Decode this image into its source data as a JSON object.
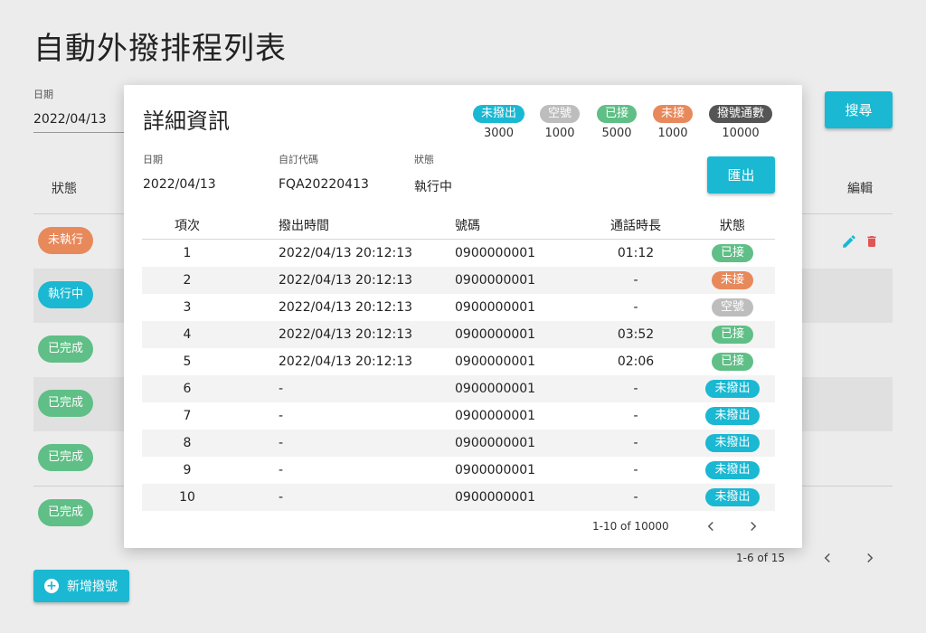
{
  "page": {
    "title": "自動外撥排程列表",
    "date_label": "日期",
    "date_value": "2022/04/13",
    "search_label": "搜尋",
    "col_status": "狀態",
    "col_edit": "編輯",
    "rows": [
      {
        "status": "未執行",
        "color": "#e8895c"
      },
      {
        "status": "執行中",
        "color": "#1ab8d2"
      },
      {
        "status": "已完成",
        "color": "#5fbf86"
      },
      {
        "status": "已完成",
        "color": "#5fbf86"
      },
      {
        "status": "已完成",
        "color": "#5fbf86"
      },
      {
        "status": "已完成",
        "color": "#5fbf86"
      }
    ],
    "pagination": "1-6 of 15",
    "add_label": "新增撥號"
  },
  "modal": {
    "title": "詳細資訊",
    "summary": [
      {
        "label": "未撥出",
        "count": "3000",
        "color": "#1ab8d2"
      },
      {
        "label": "空號",
        "count": "1000",
        "color": "#bdbdbd"
      },
      {
        "label": "已接",
        "count": "5000",
        "color": "#5fbf86"
      },
      {
        "label": "未接",
        "count": "1000",
        "color": "#e8895c"
      },
      {
        "label": "撥號通數",
        "count": "10000",
        "color": "#555555"
      }
    ],
    "info": {
      "date_label": "日期",
      "date_value": "2022/04/13",
      "code_label": "自訂代碼",
      "code_value": "FQA20220413",
      "status_label": "狀態",
      "status_value": "執行中"
    },
    "export_label": "匯出",
    "columns": {
      "no": "項次",
      "time": "撥出時間",
      "phone": "號碼",
      "duration": "通話時長",
      "status": "狀態"
    },
    "rows": [
      {
        "no": "1",
        "time": "2022/04/13 20:12:13",
        "phone": "0900000001",
        "duration": "01:12",
        "status": "已接",
        "color": "#5fbf86"
      },
      {
        "no": "2",
        "time": "2022/04/13 20:12:13",
        "phone": "0900000001",
        "duration": "-",
        "status": "未接",
        "color": "#e8895c"
      },
      {
        "no": "3",
        "time": "2022/04/13 20:12:13",
        "phone": "0900000001",
        "duration": "-",
        "status": "空號",
        "color": "#bdbdbd"
      },
      {
        "no": "4",
        "time": "2022/04/13 20:12:13",
        "phone": "0900000001",
        "duration": "03:52",
        "status": "已接",
        "color": "#5fbf86"
      },
      {
        "no": "5",
        "time": "2022/04/13 20:12:13",
        "phone": "0900000001",
        "duration": "02:06",
        "status": "已接",
        "color": "#5fbf86"
      },
      {
        "no": "6",
        "time": "-",
        "phone": "0900000001",
        "duration": "-",
        "status": "未撥出",
        "color": "#1ab8d2"
      },
      {
        "no": "7",
        "time": "-",
        "phone": "0900000001",
        "duration": "-",
        "status": "未撥出",
        "color": "#1ab8d2"
      },
      {
        "no": "8",
        "time": "-",
        "phone": "0900000001",
        "duration": "-",
        "status": "未撥出",
        "color": "#1ab8d2"
      },
      {
        "no": "9",
        "time": "-",
        "phone": "0900000001",
        "duration": "-",
        "status": "未撥出",
        "color": "#1ab8d2"
      },
      {
        "no": "10",
        "time": "-",
        "phone": "0900000001",
        "duration": "-",
        "status": "未撥出",
        "color": "#1ab8d2"
      }
    ],
    "pagination": "1-10 of 10000"
  }
}
